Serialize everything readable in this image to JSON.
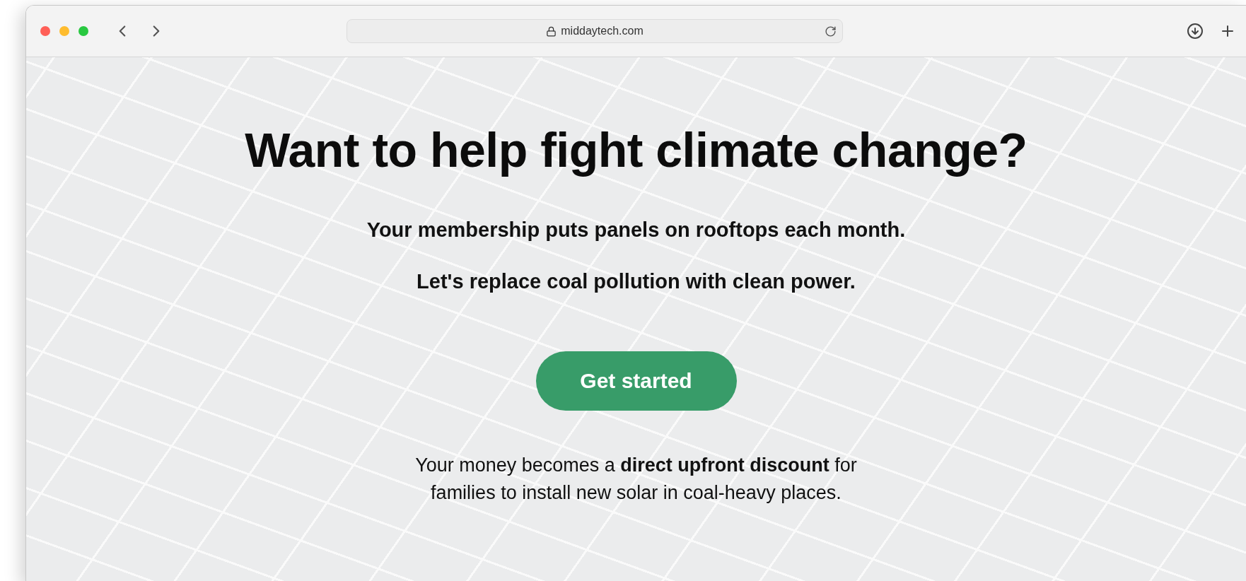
{
  "browser": {
    "url": "middaytech.com"
  },
  "hero": {
    "title": "Want to help fight climate change?",
    "lines": [
      "Your membership puts panels on rooftops each month.",
      "Let's replace coal pollution with clean power."
    ],
    "button": "Get started",
    "note_lines": [
      "Your money becomes a **direct upfront discount** for",
      "families to install new solar in coal-heavy places."
    ]
  }
}
